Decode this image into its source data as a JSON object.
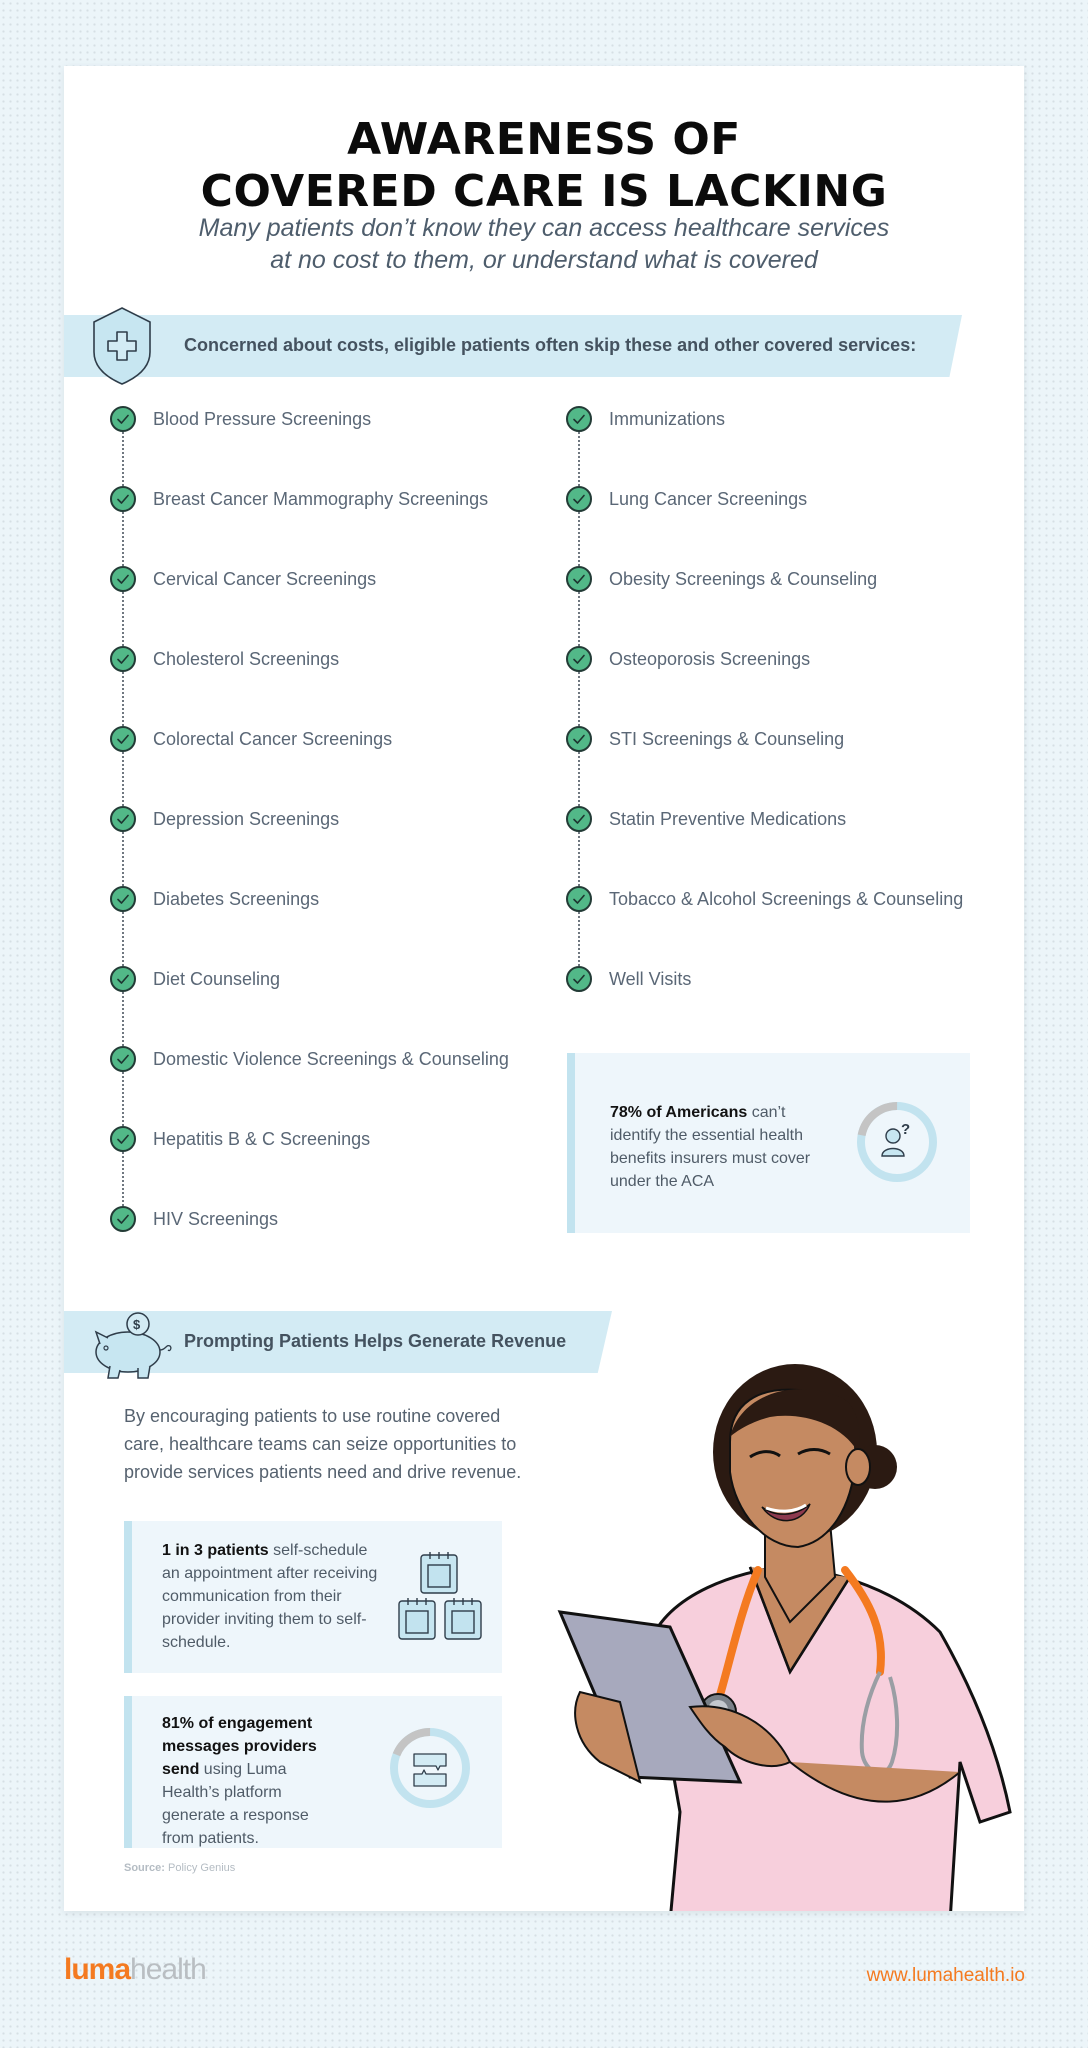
{
  "header": {
    "title_line1": "AWARENESS OF",
    "title_line2": "COVERED CARE IS LACKING",
    "subtitle_line1": "Many patients don’t know they can access healthcare services",
    "subtitle_line2": "at no cost to them, or understand what is covered"
  },
  "services_section": {
    "banner_text": "Concerned about costs, eligible patients often skip these and other covered services:",
    "icon": "shield-plus-icon",
    "left_items": [
      "Blood Pressure Screenings",
      "Breast Cancer Mammography Screenings",
      "Cervical Cancer Screenings",
      "Cholesterol Screenings",
      "Colorectal Cancer Screenings",
      "Depression Screenings",
      "Diabetes Screenings",
      "Diet Counseling",
      "Domestic Violence Screenings & Counseling",
      "Hepatitis B & C Screenings",
      "HIV Screenings"
    ],
    "right_items": [
      "Immunizations",
      "Lung Cancer Screenings",
      "Obesity Screenings & Counseling",
      "Osteoporosis Screenings",
      "STI Screenings & Counseling",
      "Statin Preventive Medications",
      "Tobacco & Alcohol Screenings & Counseling",
      "Well Visits"
    ],
    "stat": {
      "bold": "78% of Americans",
      "rest": " can’t identify the essential health benefits insurers must cover under the ACA",
      "percent": 78,
      "icon": "person-question-icon"
    }
  },
  "revenue_section": {
    "banner_text": "Prompting Patients Helps Generate Revenue",
    "icon": "piggy-bank-icon",
    "body": "By encouraging patients to use routine covered care, healthcare teams can seize opportunities to provide services patients need and drive revenue.",
    "stats": [
      {
        "bold": "1 in 3 patients",
        "rest": " self-schedule an appointment after receiving communication from their provider inviting them to self-schedule.",
        "icon": "calendars-icon"
      },
      {
        "bold": "81% of engagement messages providers send",
        "rest": " using Luma Health’s platform generate a response from patients.",
        "percent": 81,
        "icon": "chat-bubbles-icon"
      }
    ],
    "source_label": "Source:",
    "source_value": " Policy Genius"
  },
  "footer": {
    "logo_bold": "luma",
    "logo_light": "health",
    "url": "www.lumahealth.io"
  },
  "colors": {
    "accent_orange": "#f47a20",
    "check_green": "#52b888",
    "banner_blue": "#d3ebf4",
    "ring_blue": "#c2e3ef",
    "ring_gray": "#c4c4c4"
  }
}
